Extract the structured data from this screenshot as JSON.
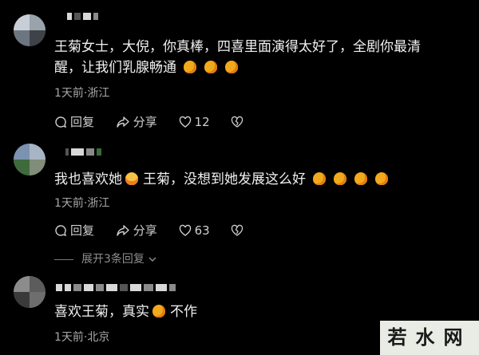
{
  "comments": [
    {
      "text_line1": "王菊女士，大倪，你真棒，四喜里面演得太好了，全剧你最清",
      "text_line2": "醒，让我们乳腺畅通",
      "meta": "1天前·浙江",
      "reply_label": "回复",
      "share_label": "分享",
      "like_count": "12"
    },
    {
      "text_line1": "我也喜欢她",
      "text_line1b": "王菊，没想到她发展这么好",
      "meta": "1天前·浙江",
      "reply_label": "回复",
      "share_label": "分享",
      "like_count": "63",
      "more_replies": "展开3条回复"
    },
    {
      "text_line1": "喜欢王菊，真实",
      "text_line1b": "不作",
      "meta": "1天前·北京"
    }
  ],
  "watermark": "若水网",
  "icons": {
    "thumb": "thumbs-up-emoji-icon",
    "cry": "crying-laughing-emoji-icon",
    "reply": "reply-bubble-icon",
    "share": "share-arrow-icon",
    "like": "heart-icon",
    "dislike": "broken-heart-icon",
    "chevron": "chevron-down-icon"
  }
}
